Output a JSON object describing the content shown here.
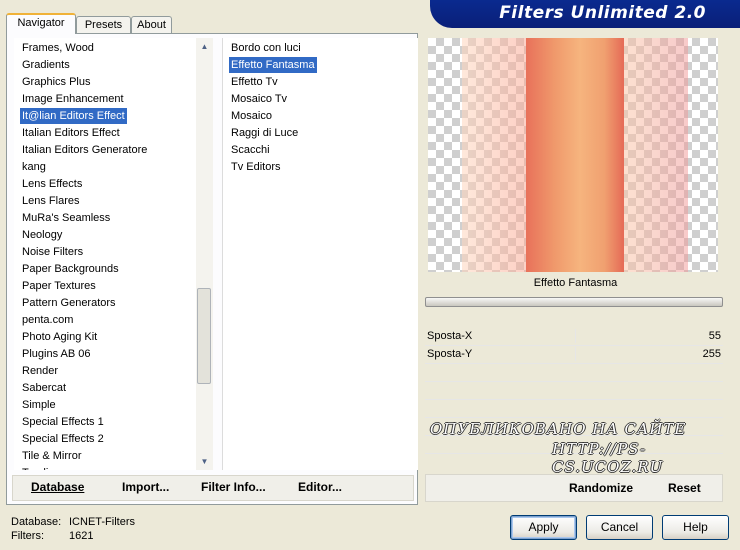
{
  "banner": {
    "title": "Filters Unlimited 2.0"
  },
  "tabs": [
    {
      "label": "Navigator",
      "active": true
    },
    {
      "label": "Presets",
      "active": false
    },
    {
      "label": "About",
      "active": false
    }
  ],
  "categories": {
    "selected": "It@lian Editors Effect",
    "items": [
      "Frames, Wood",
      "Gradients",
      "Graphics Plus",
      "Image Enhancement",
      "It@lian Editors Effect",
      "Italian Editors Effect",
      "Italian Editors Generatore",
      "kang",
      "Lens Effects",
      "Lens Flares",
      "MuRa's Seamless",
      "Neology",
      "Noise Filters",
      "Paper Backgrounds",
      "Paper Textures",
      "Pattern Generators",
      "penta.com",
      "Photo Aging Kit",
      "Plugins AB 06",
      "Render",
      "Sabercat",
      "Simple",
      "Special Effects 1",
      "Special Effects 2",
      "Tile & Mirror",
      "Toadies"
    ]
  },
  "filters": {
    "selected": "Effetto Fantasma",
    "items": [
      "Bordo con luci",
      "Effetto Fantasma",
      "Effetto Tv",
      "Mosaico Tv",
      "Mosaico",
      "Raggi di Luce",
      "Scacchi",
      "Tv Editors"
    ]
  },
  "toolbar": {
    "database": "Database",
    "import": "Import...",
    "filter_info": "Filter Info...",
    "editor": "Editor..."
  },
  "preview": {
    "filter_name": "Effetto Fantasma"
  },
  "params": [
    {
      "label": "Sposta-X",
      "value": "55"
    },
    {
      "label": "Sposta-Y",
      "value": "255"
    }
  ],
  "watermark": {
    "line1": "ОПУБЛИКОВАНО НА САЙТЕ",
    "line2": "HTTP://PS-CS.UCOZ.RU"
  },
  "right_buttons": {
    "randomize": "Randomize",
    "reset": "Reset"
  },
  "footer": {
    "database_label": "Database:",
    "database_value": "ICNET-Filters",
    "filters_label": "Filters:",
    "filters_value": "1621"
  },
  "dialog_buttons": {
    "apply": "Apply",
    "cancel": "Cancel",
    "help": "Help"
  },
  "colors": {
    "selection": "#316ac5",
    "banner": "#0a2a8f",
    "accent_tab": "#f0b238"
  }
}
